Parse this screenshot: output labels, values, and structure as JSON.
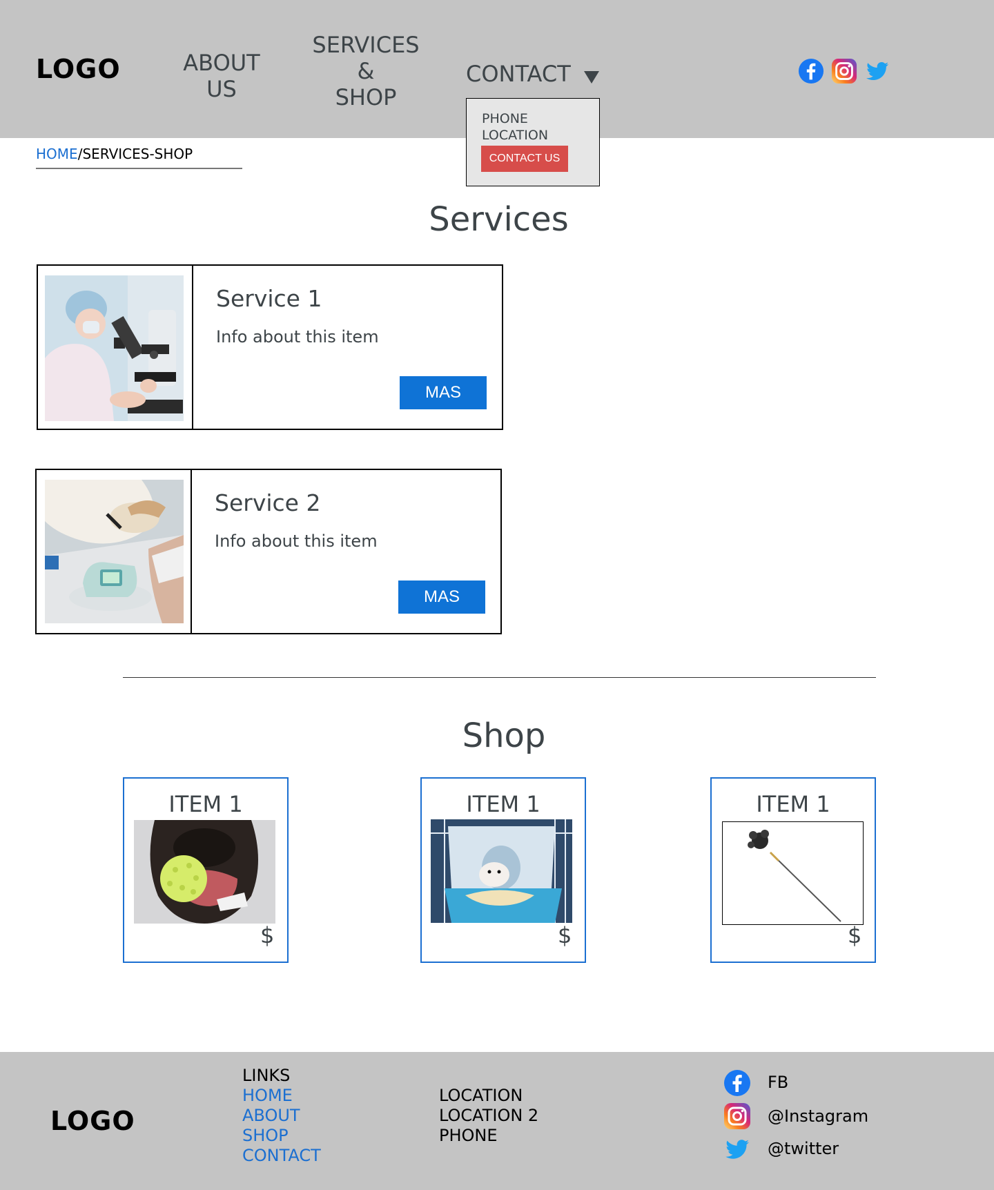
{
  "header": {
    "logo": "LOGO",
    "nav": {
      "about_line1": "ABOUT",
      "about_line2": "US",
      "services_line1": "SERVICES",
      "services_line2": "&",
      "services_line3": "SHOP",
      "contact": "CONTACT"
    },
    "social_icons": [
      "facebook-icon",
      "instagram-icon",
      "twitter-icon"
    ]
  },
  "dropdown": {
    "phone": "PHONE",
    "location": "LOCATION",
    "contact_button": "CONTACT US"
  },
  "breadcrumb": {
    "home": "HOME",
    "separator": "/",
    "current": "SERVICES-SHOP"
  },
  "services": {
    "title": "Services",
    "items": [
      {
        "title": "Service 1",
        "desc": "Info about this item",
        "button": "MAS"
      },
      {
        "title": "Service 2",
        "desc": "Info about this item",
        "button": "MAS"
      }
    ]
  },
  "shop": {
    "title": "Shop",
    "items": [
      {
        "title": "ITEM 1",
        "price": "$"
      },
      {
        "title": "ITEM 1",
        "price": "$"
      },
      {
        "title": "ITEM 1",
        "price": "$"
      }
    ]
  },
  "footer": {
    "logo": "LOGO",
    "links_heading": "LINKS",
    "links": [
      "HOME",
      "ABOUT",
      "SHOP",
      "CONTACT"
    ],
    "locations": [
      "LOCATION",
      "LOCATION 2",
      "PHONE"
    ],
    "social": {
      "fb": "FB",
      "instagram": "@Instagram",
      "twitter": "@twitter"
    }
  },
  "colors": {
    "header_bg": "#c4c4c4",
    "accent_blue": "#0f73d6",
    "link_blue": "#1b6fd1",
    "contact_red": "#d74d4a",
    "text_dark": "#3d4448"
  }
}
